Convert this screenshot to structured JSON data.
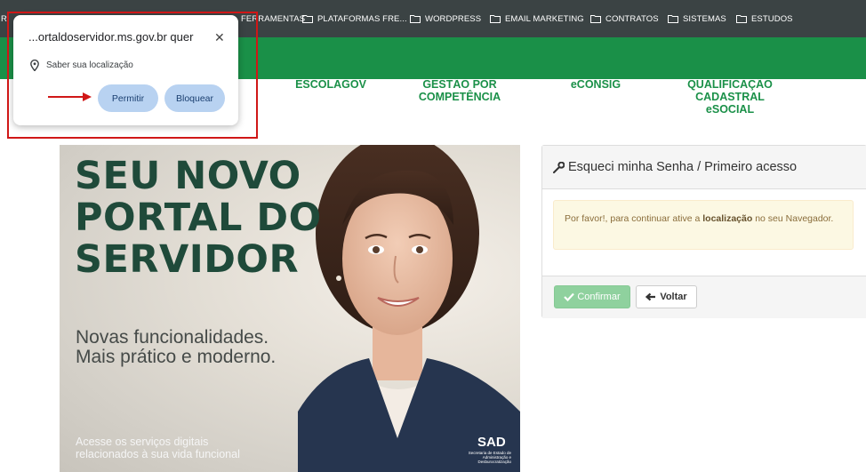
{
  "bookmarks": {
    "partial_left": "R",
    "items": [
      {
        "label": "FERRAMENTAS"
      },
      {
        "label": "PLATAFORMAS FRE..."
      },
      {
        "label": "WORDPRESS"
      },
      {
        "label": "EMAIL MARKETING"
      },
      {
        "label": "CONTRATOS"
      },
      {
        "label": "SISTEMAS"
      },
      {
        "label": "ESTUDOS"
      }
    ]
  },
  "nav": {
    "items": [
      {
        "lines": [
          "ESCOLAGOV"
        ]
      },
      {
        "lines": [
          "GESTÃO POR",
          "COMPETÊNCIA"
        ]
      },
      {
        "lines": [
          "eCONSIG"
        ]
      },
      {
        "lines": [
          "QUALIFICAÇÃO",
          "CADASTRAL",
          "eSOCIAL"
        ]
      }
    ]
  },
  "hero": {
    "title_lines": [
      "SEU NOVO",
      "PORTAL DO",
      "SERVIDOR"
    ],
    "subtitle_lines": [
      "Novas funcionalidades.",
      "Mais prático e moderno."
    ],
    "footer_lines": [
      "Acesse os serviços digitais",
      "relacionados à sua vida funcional"
    ],
    "logo": "SAD",
    "logo_sub": [
      "Secretaria de Estado de",
      "Administração e Desburocratização"
    ]
  },
  "card": {
    "title": "Esqueci minha Senha / Primeiro acesso",
    "alert_prefix": "Por favor!, para continuar ative a ",
    "alert_bold": "localização",
    "alert_suffix": " no seu Navegador.",
    "confirm_label": "Confirmar",
    "back_label": "Voltar"
  },
  "permission_popup": {
    "site": "...ortaldoservidor.ms.gov.br quer",
    "request": "Saber sua localização",
    "allow_label": "Permitir",
    "block_label": "Bloquear",
    "close_icon": "close-icon"
  },
  "colors": {
    "bookmark_bar": "#3b4344",
    "brand_green": "#1a9048",
    "hero_text": "#1f4a3a",
    "popup_button": "#b8d2f1",
    "annotation_red": "#d01717"
  }
}
